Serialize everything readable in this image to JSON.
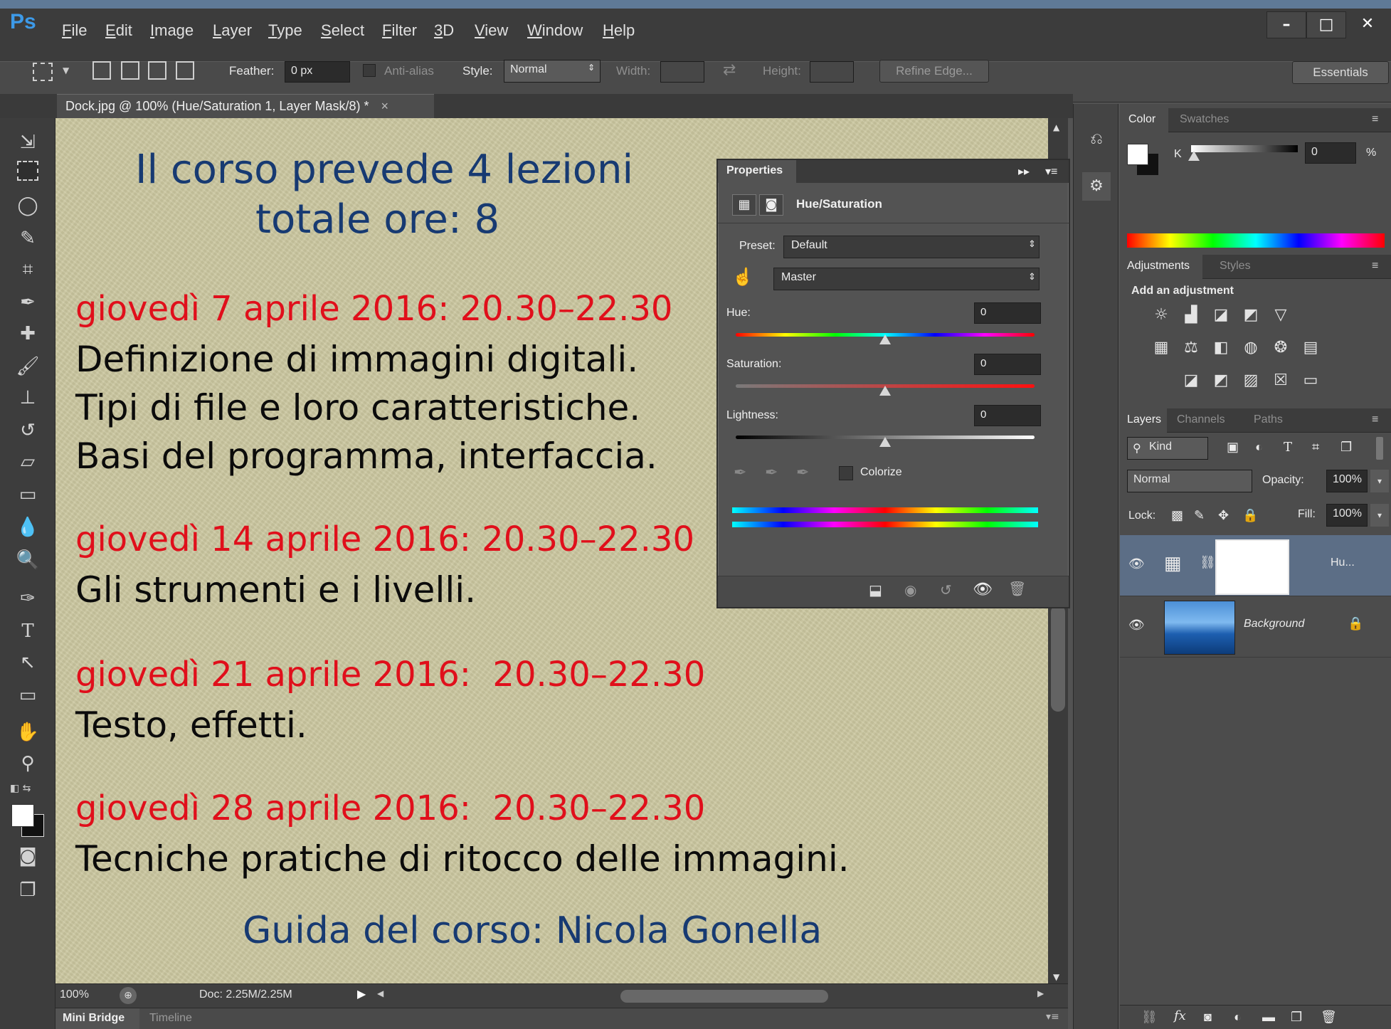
{
  "app": {
    "logo": "Ps"
  },
  "menu": [
    "File",
    "Edit",
    "Image",
    "Layer",
    "Type",
    "Select",
    "Filter",
    "3D",
    "View",
    "Window",
    "Help"
  ],
  "window_controls": {
    "minimize": "–",
    "maximize": "□",
    "close": "✕"
  },
  "options": {
    "feather_label": "Feather:",
    "feather_value": "0 px",
    "antialias_label": "Anti-alias",
    "style_label": "Style:",
    "style_value": "Normal",
    "width_label": "Width:",
    "height_label": "Height:",
    "refine_edge": "Refine Edge...",
    "workspace": "Essentials"
  },
  "document": {
    "tab_title": "Dock.jpg @ 100% (Hue/Saturation 1, Layer Mask/8) *",
    "tab_close": "×",
    "heading1": "Il corso prevede 4 lezioni",
    "heading2": "totale ore: 8",
    "lessons": [
      {
        "date": "giovedì 7 aprile 2016: 20.30–22.30",
        "lines": [
          "Definizione di immagini digitali.",
          "Tipi di file e loro caratteristiche.",
          "Basi del programma, interfaccia."
        ]
      },
      {
        "date": "giovedì 14 aprile 2016: 20.30–22.30",
        "lines": [
          "Gli strumenti e i livelli."
        ]
      },
      {
        "date": "giovedì 21 aprile 2016:  20.30–22.30",
        "lines": [
          "Testo, effetti."
        ]
      },
      {
        "date": "giovedì 28 aprile 2016:  20.30–22.30",
        "lines": [
          "Tecniche pratiche di ritocco delle immagini."
        ]
      }
    ],
    "footer": "Guida del corso: Nicola Gonella"
  },
  "status": {
    "zoom": "100%",
    "doc": "Doc: 2.25M/2.25M"
  },
  "bottom_tabs": [
    "Mini Bridge",
    "Timeline"
  ],
  "properties": {
    "title": "Properties",
    "adjustment": "Hue/Saturation",
    "preset_label": "Preset:",
    "preset_value": "Default",
    "channel_value": "Master",
    "hue_label": "Hue:",
    "hue_value": "0",
    "saturation_label": "Saturation:",
    "saturation_value": "0",
    "lightness_label": "Lightness:",
    "lightness_value": "0",
    "colorize_label": "Colorize"
  },
  "color_panel": {
    "tabs": [
      "Color",
      "Swatches"
    ],
    "channel": "K",
    "value": "0",
    "unit": "%"
  },
  "adjustments_panel": {
    "tabs": [
      "Adjustments",
      "Styles"
    ],
    "hint": "Add an adjustment"
  },
  "layers_panel": {
    "tabs": [
      "Layers",
      "Channels",
      "Paths"
    ],
    "filter": "Kind",
    "blend_mode": "Normal",
    "opacity_label": "Opacity:",
    "opacity_value": "100%",
    "lock_label": "Lock:",
    "fill_label": "Fill:",
    "fill_value": "100%",
    "layers": [
      {
        "name": "Hu...",
        "selected": true
      },
      {
        "name": "Background",
        "selected": false
      }
    ]
  },
  "colors": {
    "canvas": "#cbc7a0",
    "heading_blue": "#173a72",
    "date_red": "#e00f1b",
    "ps_blue": "#3d9ae8"
  }
}
